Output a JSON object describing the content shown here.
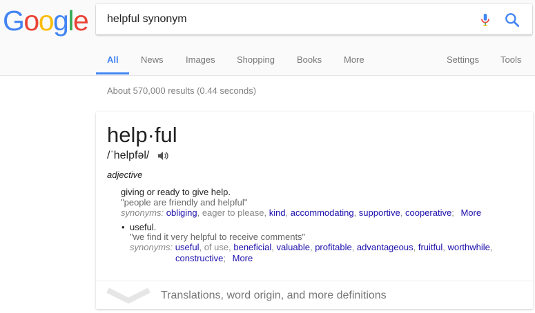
{
  "logo": {
    "letters": [
      "G",
      "o",
      "o",
      "g",
      "l",
      "e"
    ],
    "colors": [
      "#4285f4",
      "#ea4335",
      "#fbbc05",
      "#4285f4",
      "#34a853",
      "#ea4335"
    ]
  },
  "search": {
    "query": "helpful synonym"
  },
  "tabs": {
    "all": "All",
    "news": "News",
    "images": "Images",
    "shopping": "Shopping",
    "books": "Books",
    "more": "More",
    "settings": "Settings",
    "tools": "Tools"
  },
  "result_stats": "About 570,000 results (0.44 seconds)",
  "definition": {
    "word": "help·ful",
    "pronunciation": "/ˈhelpfəl/",
    "part_of_speech": "adjective",
    "sense1": {
      "definition": "giving or ready to give help.",
      "example": "\"people are friendly and helpful\"",
      "synonyms_label": "synonyms:",
      "synonyms": [
        "obliging",
        "eager to please",
        "kind",
        "accommodating",
        "supportive",
        "cooperative"
      ],
      "more": "More"
    },
    "sense2": {
      "bullet": "•",
      "definition": "useful.",
      "example": "\"we find it very helpful to receive comments\"",
      "synonyms_label": "synonyms:",
      "synonyms_line1": [
        "useful",
        "of use",
        "beneficial",
        "valuable",
        "profitable",
        "advantageous",
        "fruitful",
        "worthwhile"
      ],
      "synonyms_line2": [
        "constructive"
      ],
      "more": "More"
    }
  },
  "footer_link": "Translations, word origin, and more definitions",
  "colors": {
    "accent": "#4285f4",
    "link": "#1a0dab"
  }
}
